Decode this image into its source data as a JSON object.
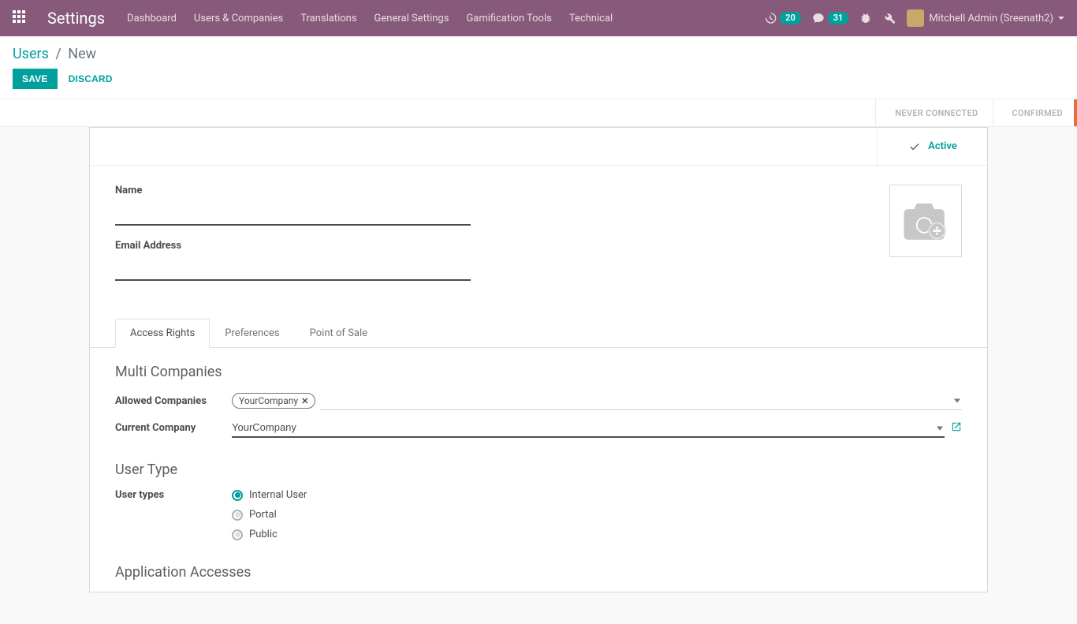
{
  "navbar": {
    "title": "Settings",
    "menu": [
      "Dashboard",
      "Users & Companies",
      "Translations",
      "General Settings",
      "Gamification Tools",
      "Technical"
    ],
    "activities_count": "20",
    "messages_count": "31",
    "user_name": "Mitchell Admin (Sreenath2)"
  },
  "breadcrumb": {
    "parent": "Users",
    "current": "New"
  },
  "actions": {
    "save": "SAVE",
    "discard": "DISCARD"
  },
  "statusbar": {
    "never_connected": "NEVER CONNECTED",
    "confirmed": "CONFIRMED"
  },
  "active_button": "Active",
  "form": {
    "name_label": "Name",
    "name_value": "",
    "email_label": "Email Address",
    "email_value": ""
  },
  "tabs": {
    "access_rights": "Access Rights",
    "preferences": "Preferences",
    "point_of_sale": "Point of Sale"
  },
  "sections": {
    "multi_companies": {
      "title": "Multi Companies",
      "allowed_label": "Allowed Companies",
      "allowed_tag": "YourCompany",
      "current_label": "Current Company",
      "current_value": "YourCompany"
    },
    "user_type": {
      "title": "User Type",
      "label": "User types",
      "options": {
        "internal": "Internal User",
        "portal": "Portal",
        "public": "Public"
      },
      "selected": "internal"
    },
    "app_accesses": {
      "title": "Application Accesses"
    }
  },
  "colors": {
    "primary": "#00a09d",
    "navbar": "#875a7b",
    "accent": "#e46f41"
  }
}
